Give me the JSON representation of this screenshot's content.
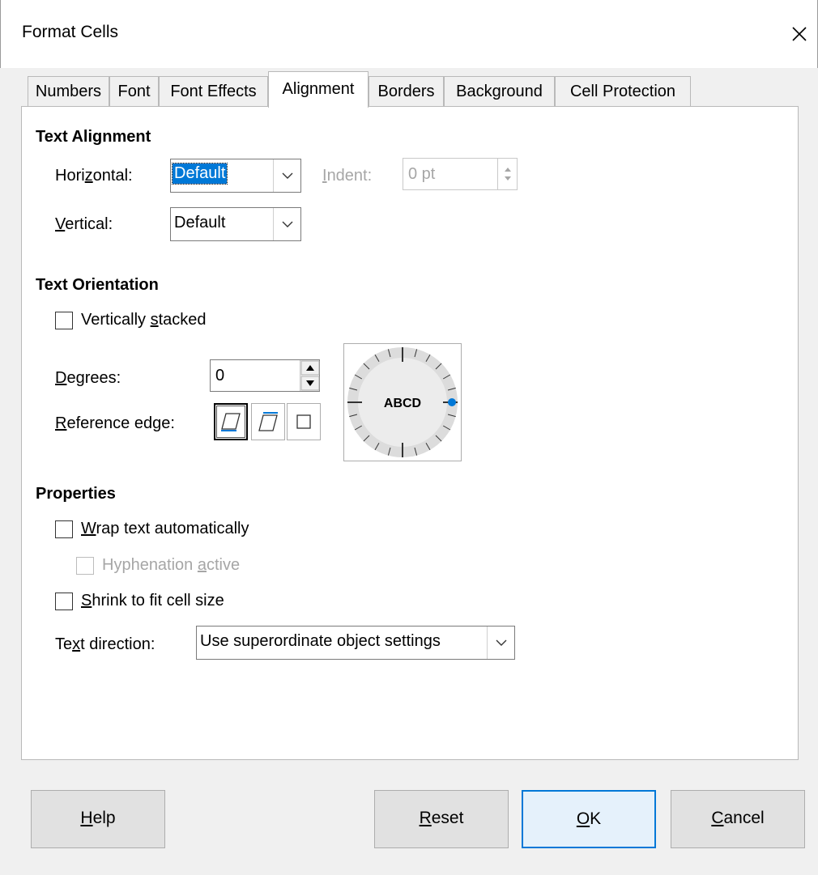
{
  "window": {
    "title": "Format Cells",
    "close_icon": "close-icon"
  },
  "tabs": [
    {
      "label": "Numbers"
    },
    {
      "label": "Font"
    },
    {
      "label": "Font Effects"
    },
    {
      "label": "Alignment",
      "active": true
    },
    {
      "label": "Borders"
    },
    {
      "label": "Background"
    },
    {
      "label": "Cell Protection"
    }
  ],
  "text_alignment": {
    "heading": "Text Alignment",
    "horizontal": {
      "label_pre": "Hori",
      "label_key": "z",
      "label_post": "ontal:",
      "value": "Default"
    },
    "indent": {
      "label_pre": "",
      "label_key": "I",
      "label_post": "ndent:",
      "value": "0 pt"
    },
    "vertical": {
      "label_pre": "",
      "label_key": "V",
      "label_post": "ertical:",
      "value": "Default"
    }
  },
  "text_orientation": {
    "heading": "Text Orientation",
    "vertically_stacked": {
      "label_pre": "Vertically ",
      "label_key": "s",
      "label_post": "tacked",
      "checked": false
    },
    "degrees": {
      "label_pre": "",
      "label_key": "D",
      "label_post": "egrees:",
      "value": "0"
    },
    "reference_edge": {
      "label_pre": "",
      "label_key": "R",
      "label_post": "eference edge:",
      "options": [
        "bottom-edge-icon",
        "top-edge-icon",
        "inside-cell-icon"
      ],
      "selected_index": 0
    },
    "dial_text": "ABCD",
    "dial_accent": "#0078d7"
  },
  "properties": {
    "heading": "Properties",
    "wrap": {
      "label_pre": "",
      "label_key": "W",
      "label_post": "rap text automatically",
      "checked": false
    },
    "hyphenation": {
      "label_pre": "Hyphenation ",
      "label_key": "a",
      "label_post": "ctive",
      "checked": false,
      "disabled": true
    },
    "shrink": {
      "label_pre": "",
      "label_key": "S",
      "label_post": "hrink to fit cell size",
      "checked": false
    },
    "text_direction": {
      "label_pre": "Te",
      "label_key": "x",
      "label_post": "t direction:",
      "value": "Use superordinate object settings"
    }
  },
  "buttons": {
    "help": {
      "label_pre": "",
      "label_key": "H",
      "label_post": "elp"
    },
    "reset": {
      "label_pre": "",
      "label_key": "R",
      "label_post": "eset"
    },
    "ok": {
      "label_pre": "",
      "label_key": "O",
      "label_post": "K"
    },
    "cancel": {
      "label_pre": "",
      "label_key": "C",
      "label_post": "ancel"
    }
  }
}
